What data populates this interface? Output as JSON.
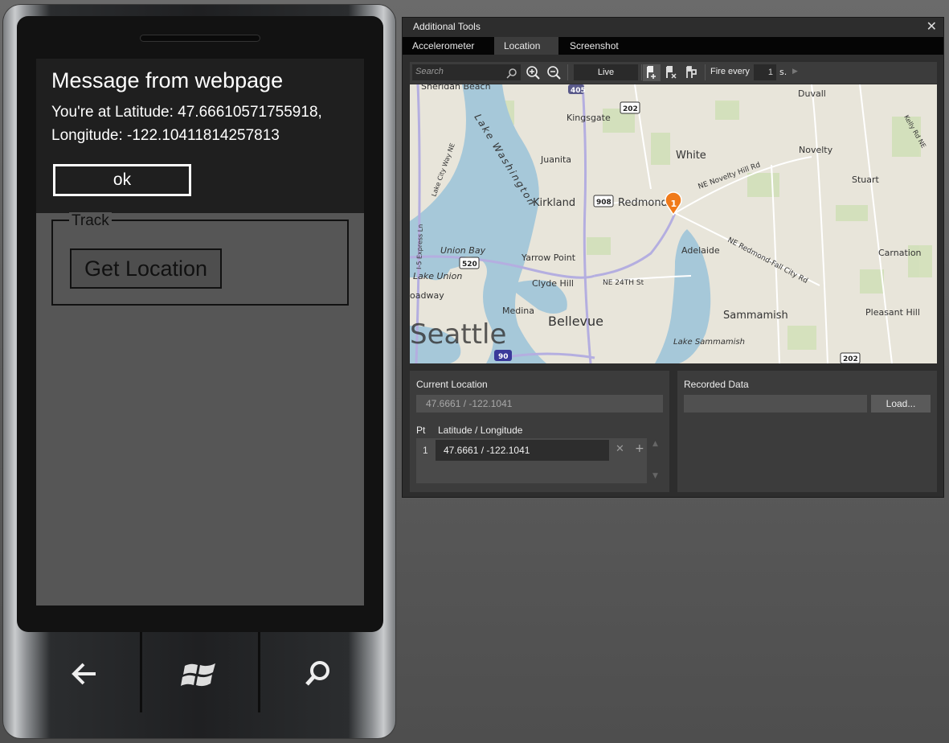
{
  "phone": {
    "message_box": {
      "title": "Message from webpage",
      "body_line1": "You're at Latitude: 47.66610571755918,",
      "body_line2": "Longitude: -122.10411814257813",
      "ok_label": "ok"
    },
    "fieldset_legend": "Track",
    "get_location_label": "Get Location",
    "hardware_buttons": [
      "back-arrow-icon",
      "windows-start-icon",
      "search-icon"
    ]
  },
  "tools": {
    "title": "Additional Tools",
    "close_glyph": "✕",
    "tabs": [
      {
        "label": "Accelerometer",
        "active": false
      },
      {
        "label": "Location",
        "active": true
      },
      {
        "label": "Screenshot",
        "active": false
      }
    ],
    "toolbar": {
      "search_placeholder": "Search",
      "live_label": "Live",
      "fire_every_label": "Fire every",
      "fire_every_value": "1",
      "fire_every_unit": "s."
    },
    "map": {
      "labels": {
        "sheridan_beach": "Sheridan Beach",
        "duvall": "Duvall",
        "kingsgate": "Kingsgate",
        "white": "White",
        "novelty": "Novelty",
        "juanita": "Juanita",
        "stuart": "Stuart",
        "kirkland": "Kirkland",
        "redmond": "Redmond",
        "adelaide": "Adelaide",
        "carnation": "Carnation",
        "yarrow_point": "Yarrow Point",
        "clyde_hill": "Clyde Hill",
        "union_bay": "Union Bay",
        "lake_union": "Lake Union",
        "broadway": "oadway",
        "medina": "Medina",
        "bellevue": "Bellevue",
        "sammamish": "Sammamish",
        "pleasant_hill": "Pleasant Hill",
        "seattle": "Seattle",
        "lake_washington": "Lake Washington",
        "lake_sammamish": "Lake Sammamish",
        "ne_novelty_hill_rd": "NE Novelty Hill Rd",
        "ne_redmond_fall_city_rd": "NE Redmond-Fall City Rd",
        "ne_24th_st": "NE 24TH St",
        "lake_city_way": "Lake City Way NE",
        "i5_express": "I-5 Express Ln",
        "kelly_rd": "Kelly Rd NE",
        "shields": [
          "405",
          "202",
          "908",
          "520",
          "90",
          "202"
        ]
      },
      "pin_number": "1"
    },
    "current_location": {
      "title": "Current Location",
      "value": "47.6661 / -122.1041",
      "col_pt": "Pt",
      "col_latlong": "Latitude / Longitude",
      "points": [
        {
          "num": "1",
          "value": "47.6661 / -122.1041"
        }
      ]
    },
    "recorded_data": {
      "title": "Recorded Data",
      "load_label": "Load..."
    }
  }
}
